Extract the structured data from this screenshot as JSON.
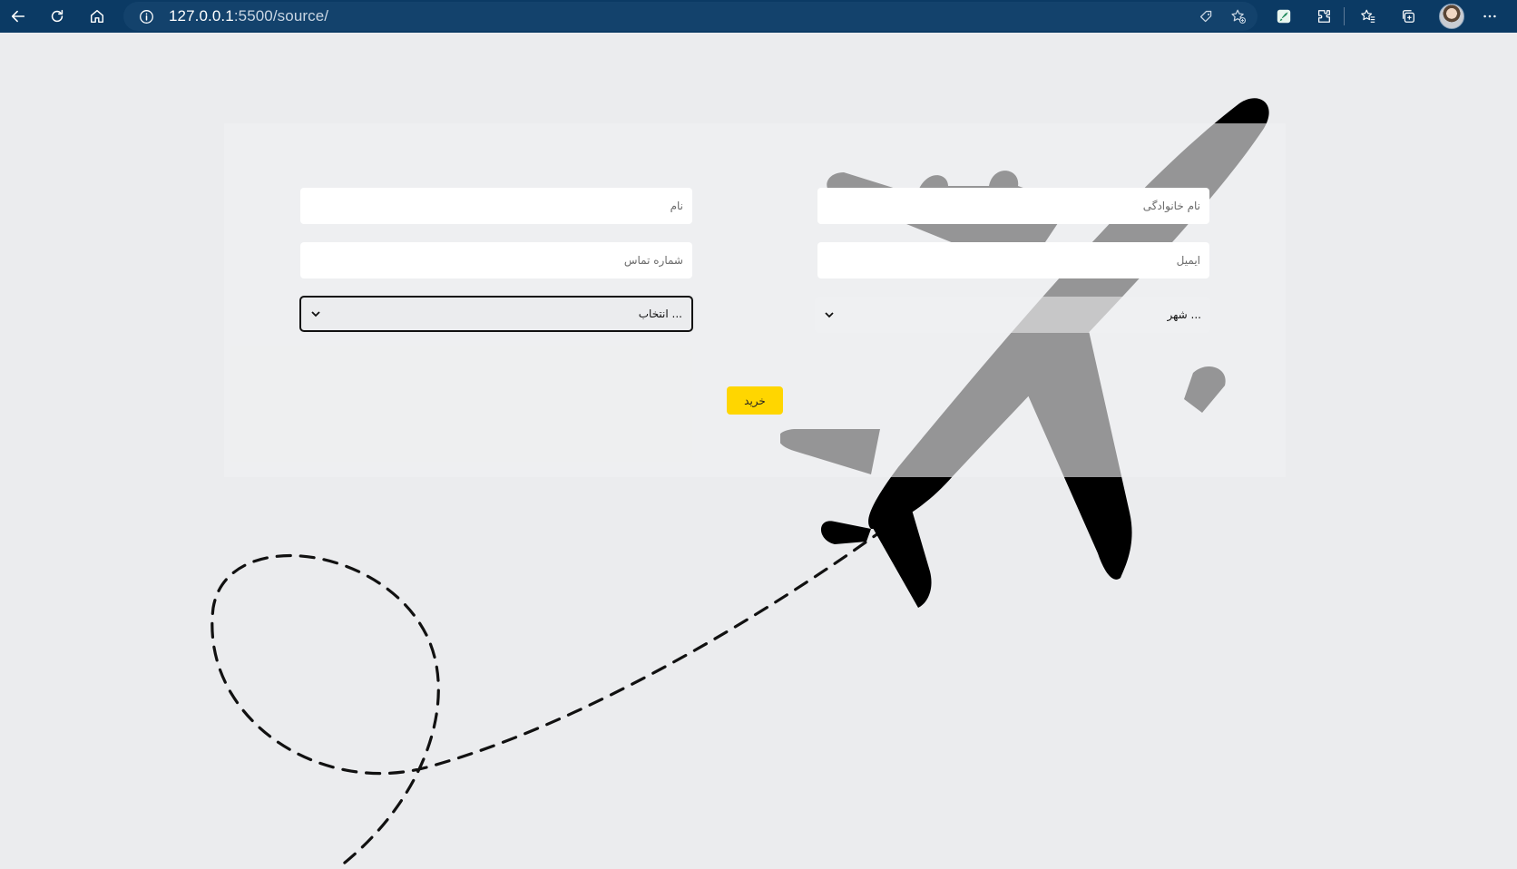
{
  "browser": {
    "url_host": "127.0.0.1",
    "url_rest": ":5500/source/",
    "colors": {
      "toolbar": "#0b3a64",
      "urlbar": "#13426c"
    },
    "icons": [
      "back-icon",
      "refresh-icon",
      "home-icon",
      "info-icon",
      "tag-icon",
      "favorite-add-icon",
      "extension-rocket-icon",
      "extensions-icon",
      "favorites-icon",
      "collections-icon",
      "profile-avatar",
      "more-icon"
    ]
  },
  "form": {
    "first_name_placeholder": "نام",
    "last_name_placeholder": "نام خانوادگی",
    "phone_placeholder": "شماره تماس",
    "email_placeholder": "ایمیل",
    "select_value": "انتخاب ...",
    "city_value": "شهر ...",
    "buy_label": "خرید",
    "colors": {
      "button": "#ffd600",
      "background": "#ebecee",
      "plane": "#000000"
    }
  }
}
